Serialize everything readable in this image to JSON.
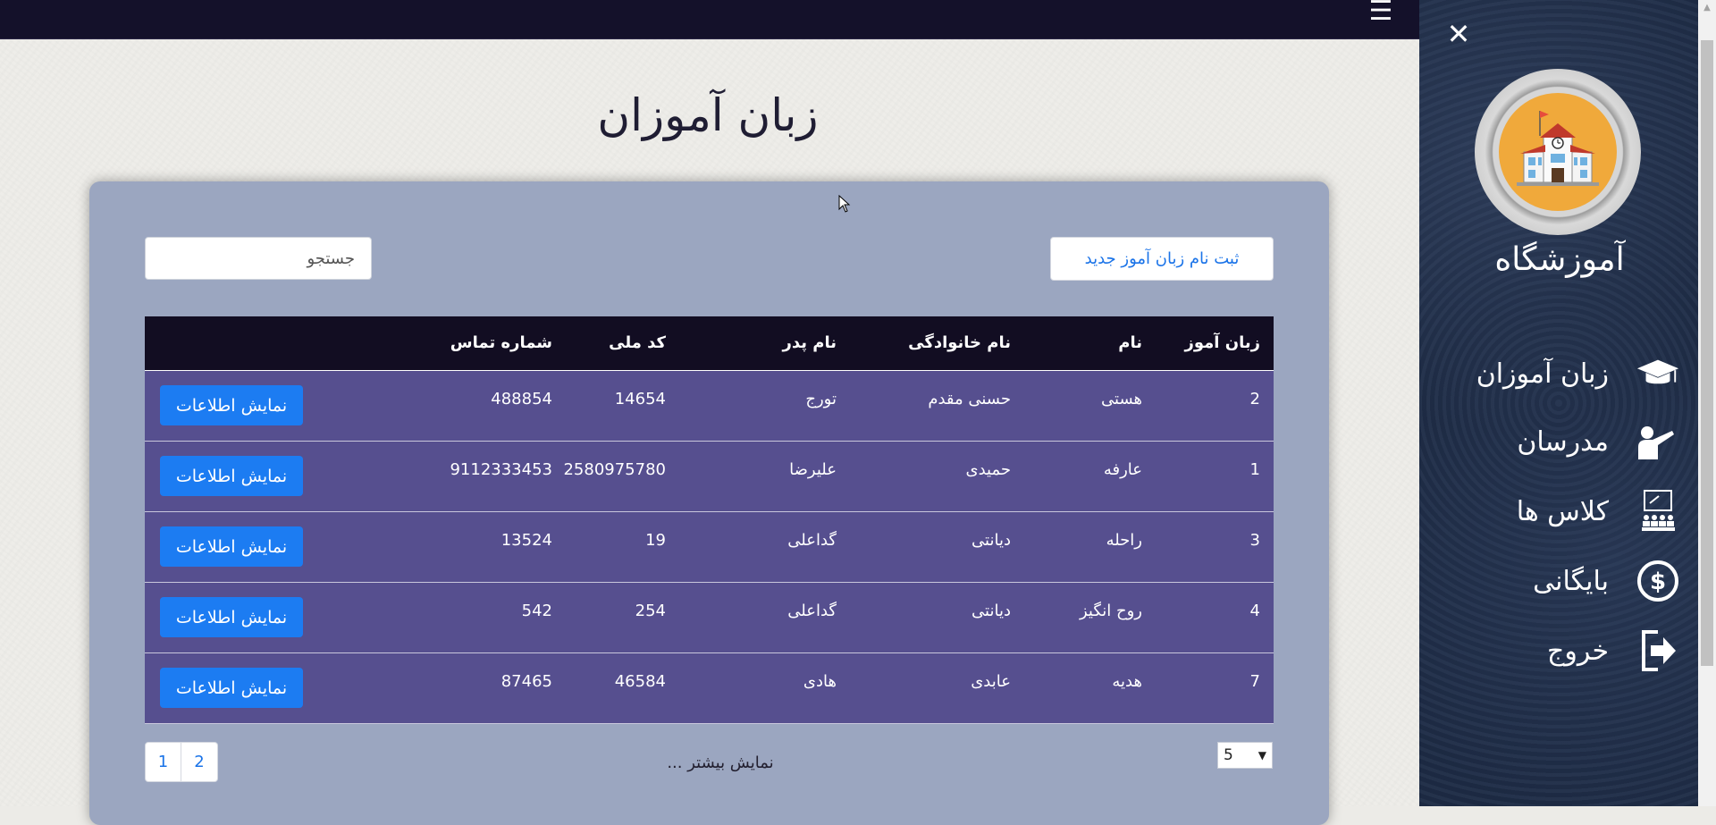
{
  "page": {
    "title": "زبان آموزان"
  },
  "toolbar": {
    "register_label": "ثبت نام زبان آموز جدید",
    "search_placeholder": "جستجو"
  },
  "table": {
    "headers": [
      "زبان آموز",
      "نام",
      "نام خانوادگی",
      "نام پدر",
      "کد ملی",
      "شماره تماس"
    ],
    "action_label": "نمایش اطلاعات",
    "rows": [
      {
        "id": "2",
        "first": "هستی",
        "last": "حسنی مقدم",
        "father": "تورج",
        "national": "14654",
        "phone": "488854"
      },
      {
        "id": "1",
        "first": "عارفه",
        "last": "حمیدی",
        "father": "علیرضا",
        "national": "2580975780",
        "phone": "9112333453"
      },
      {
        "id": "3",
        "first": "راحله",
        "last": "دیانتی",
        "father": "گداعلی",
        "national": "19",
        "phone": "13524"
      },
      {
        "id": "4",
        "first": "روح انگیز",
        "last": "دیانتی",
        "father": "گداعلی",
        "national": "254",
        "phone": "542"
      },
      {
        "id": "7",
        "first": "هدیه",
        "last": "عابدی",
        "father": "هادی",
        "national": "46584",
        "phone": "87465"
      }
    ]
  },
  "pagination": {
    "pages": [
      "1",
      "2"
    ],
    "show_more": "نمایش بیشتر ...",
    "page_size": "5"
  },
  "sidebar": {
    "brand": "آموزشگاه",
    "items": [
      {
        "label": "زبان آموزان",
        "icon": "graduation-cap-icon"
      },
      {
        "label": "مدرسان",
        "icon": "teacher-icon"
      },
      {
        "label": "کلاس ها",
        "icon": "classroom-icon"
      },
      {
        "label": "بایگانی",
        "icon": "dollar-icon"
      },
      {
        "label": "خروج",
        "icon": "logout-icon"
      }
    ]
  },
  "colors": {
    "accent": "#1c7cf2",
    "header_bg": "#120d22",
    "row_bg": "#564f8f",
    "panel_bg": "#9ba6c0",
    "topbar_bg": "#14112a",
    "sidebar_bg": "#1d2b45"
  }
}
